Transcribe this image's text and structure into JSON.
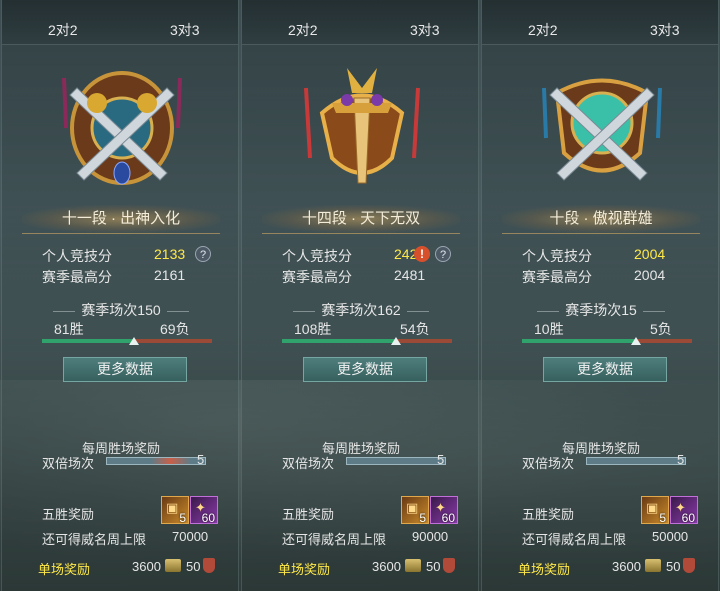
{
  "panels": [
    {
      "tabs": [
        "2对2",
        "3对3"
      ],
      "emblem": "bronze-crossed-swords-emblem-icon",
      "rank_title": "十一段 · 出神入化",
      "personal_score_label": "个人竞技分",
      "personal_score": "2133",
      "season_high_label": "赛季最高分",
      "season_high": "2161",
      "season_matches": "赛季场次150",
      "wins": "81胜",
      "losses": "69负",
      "win_rate": 0.54,
      "more_data": "更多数据",
      "weekly_title": "每周胜场奖励",
      "double_label": "双倍场次",
      "double_count": "5",
      "five_win_label": "五胜奖励",
      "chest_count": "5",
      "crystal_count": "60",
      "limit_label": "还可得威名周上限",
      "limit_value": "70000",
      "single_label": "单场奖励",
      "gold": "3600",
      "honor": "50"
    },
    {
      "tabs": [
        "2对2",
        "3对3"
      ],
      "emblem": "golden-winged-sword-emblem-icon",
      "rank_title": "十四段 · 天下无双",
      "personal_score_label": "个人竞技分",
      "personal_score": "2423",
      "season_high_label": "赛季最高分",
      "season_high": "2481",
      "season_matches": "赛季场次162",
      "wins": "108胜",
      "losses": "54负",
      "win_rate": 0.667,
      "more_data": "更多数据",
      "weekly_title": "每周胜场奖励",
      "double_label": "双倍场次",
      "double_count": "5",
      "five_win_label": "五胜奖励",
      "chest_count": "5",
      "crystal_count": "60",
      "limit_label": "还可得威名周上限",
      "limit_value": "90000",
      "single_label": "单场奖励",
      "gold": "3600",
      "honor": "50"
    },
    {
      "tabs": [
        "2对2",
        "3对3"
      ],
      "emblem": "jade-shield-sword-emblem-icon",
      "rank_title": "十段 · 傲视群雄",
      "personal_score_label": "个人竞技分",
      "personal_score": "2004",
      "season_high_label": "赛季最高分",
      "season_high": "2004",
      "season_matches": "赛季场次15",
      "wins": "10胜",
      "losses": "5负",
      "win_rate": 0.667,
      "more_data": "更多数据",
      "weekly_title": "每周胜场奖励",
      "double_label": "双倍场次",
      "double_count": "5",
      "five_win_label": "五胜奖励",
      "chest_count": "5",
      "crystal_count": "60",
      "limit_label": "还可得威名周上限",
      "limit_value": "50000",
      "single_label": "单场奖励",
      "gold": "3600",
      "honor": "50"
    }
  ],
  "colors": {
    "score": "#ffe94a",
    "win_bar": "#2fa36b",
    "loss_bar": "#9a4a36",
    "button": "#3f6b69"
  }
}
